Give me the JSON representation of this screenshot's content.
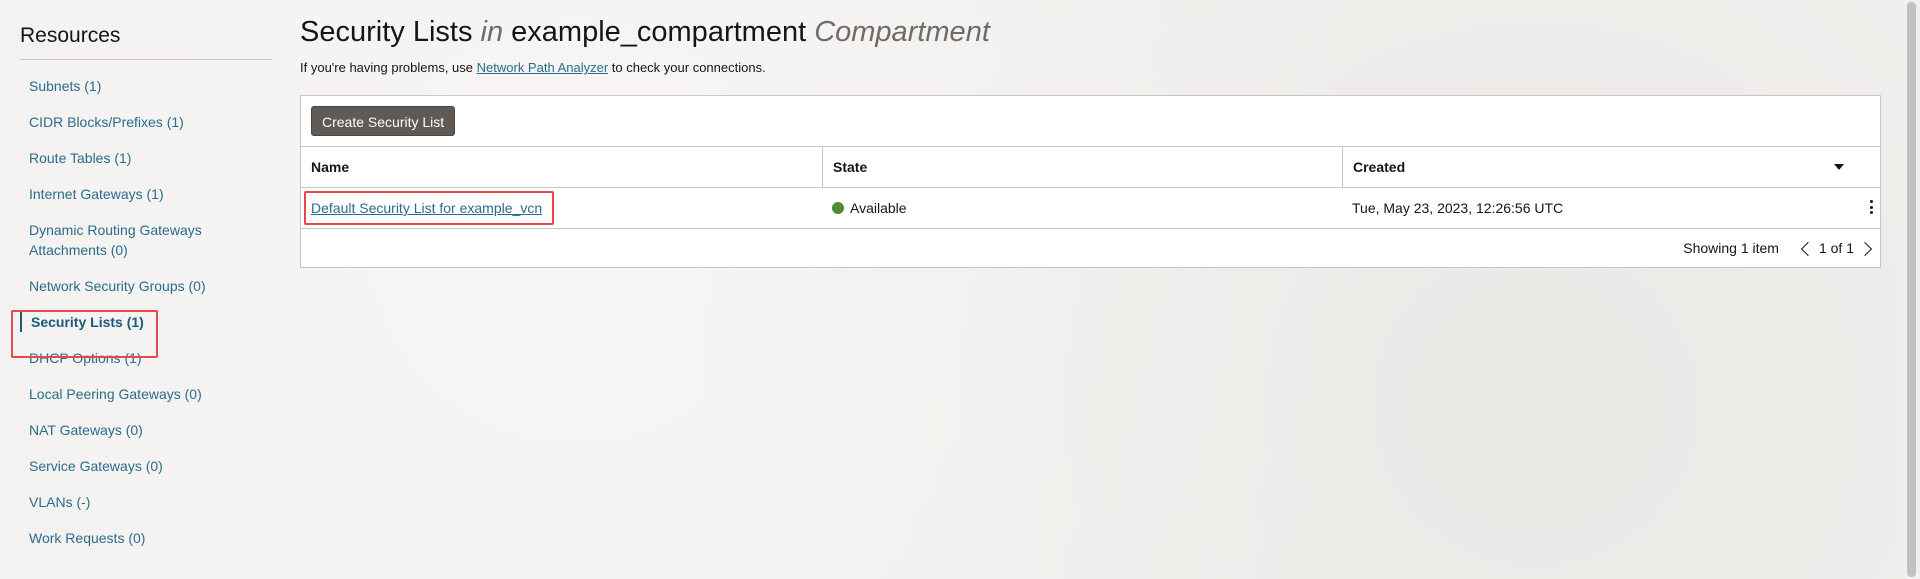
{
  "sidebar": {
    "title": "Resources",
    "items": [
      {
        "label": "Subnets (1)"
      },
      {
        "label": "CIDR Blocks/Prefixes (1)"
      },
      {
        "label": "Route Tables (1)"
      },
      {
        "label": "Internet Gateways (1)"
      },
      {
        "label": "Dynamic Routing Gateways Attachments (0)"
      },
      {
        "label": "Network Security Groups (0)"
      },
      {
        "label": "Security Lists (1)"
      },
      {
        "label": "DHCP Options (1)"
      },
      {
        "label": "Local Peering Gateways (0)"
      },
      {
        "label": "NAT Gateways (0)"
      },
      {
        "label": "Service Gateways (0)"
      },
      {
        "label": "VLANs (-)"
      },
      {
        "label": "Work Requests (0)"
      }
    ],
    "active_index": 6
  },
  "header": {
    "title_main": "Security Lists",
    "title_in": "in",
    "compartment_name": "example_compartment",
    "title_suffix": "Compartment",
    "help_prefix": "If you're having problems, use ",
    "help_link": "Network Path Analyzer",
    "help_suffix": " to check your connections."
  },
  "toolbar": {
    "create_label": "Create Security List"
  },
  "table": {
    "columns": [
      "Name",
      "State",
      "Created"
    ],
    "rows": [
      {
        "name": "Default Security List for example_vcn",
        "state": "Available",
        "created": "Tue, May 23, 2023, 12:26:56 UTC"
      }
    ],
    "status_color": "#558b2f"
  },
  "pagination": {
    "showing": "Showing 1 item",
    "page": "1 of 1"
  },
  "colors": {
    "link": "#2a6c8c",
    "highlight": "#e8474b",
    "button": "#5f5a55"
  },
  "icons": [
    "sort-caret-icon",
    "status-dot-icon",
    "kebab-menu-icon",
    "chevron-left-icon",
    "chevron-right-icon"
  ]
}
